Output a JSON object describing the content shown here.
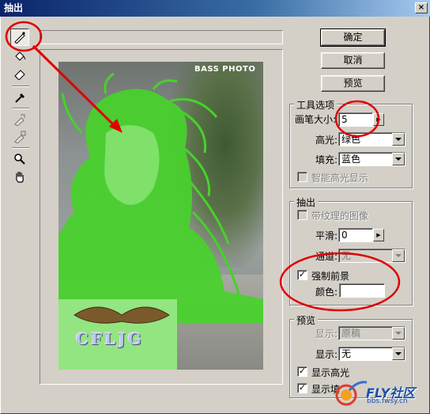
{
  "window": {
    "title": "抽出",
    "close_glyph": "×"
  },
  "toolbox": {
    "tools": [
      {
        "name": "edge-highlighter-tool",
        "active": true
      },
      {
        "name": "fill-tool",
        "active": false
      },
      {
        "name": "eraser-tool",
        "active": false
      },
      {
        "name": "eyedropper-tool",
        "active": false
      },
      {
        "name": "cleanup-tool",
        "active": false,
        "disabled": true
      },
      {
        "name": "edge-touchup-tool",
        "active": false,
        "disabled": true
      },
      {
        "name": "zoom-tool",
        "active": false
      },
      {
        "name": "hand-tool",
        "active": false
      }
    ]
  },
  "preview": {
    "watermark_top": "BASS PHOTO",
    "watermark_bottom": "CFLJG",
    "highlight_color": "#00ff00"
  },
  "buttons": {
    "ok": "确定",
    "cancel": "取消",
    "preview": "预览"
  },
  "tool_options": {
    "group_title": "工具选项",
    "brush_size_label": "画笔大小:",
    "brush_size_value": "5",
    "highlight_label": "高光:",
    "highlight_value": "绿色",
    "fill_label": "填充:",
    "fill_value": "蓝色",
    "smart_highlight_label": "智能高光显示",
    "smart_highlight_checked": false
  },
  "extraction": {
    "group_title": "抽出",
    "textured_label": "带纹理的图像",
    "textured_checked": false,
    "smooth_label": "平滑:",
    "smooth_value": "0",
    "channel_label": "通道:",
    "channel_value": "无",
    "force_fg_label": "强制前景",
    "force_fg_checked": true,
    "color_label": "颜色:",
    "color_value": "#ffffff"
  },
  "preview_group": {
    "group_title": "预览",
    "show_label": "显示:",
    "show_value": "原稿",
    "display_label": "显示:",
    "display_value": "无",
    "show_highlight_label": "显示高光",
    "show_highlight_checked": true,
    "show_fill_label": "显示填",
    "show_fill_checked": true
  },
  "watermark": {
    "brand": "FLY社区",
    "url": "bbs.fwsy.cn"
  }
}
